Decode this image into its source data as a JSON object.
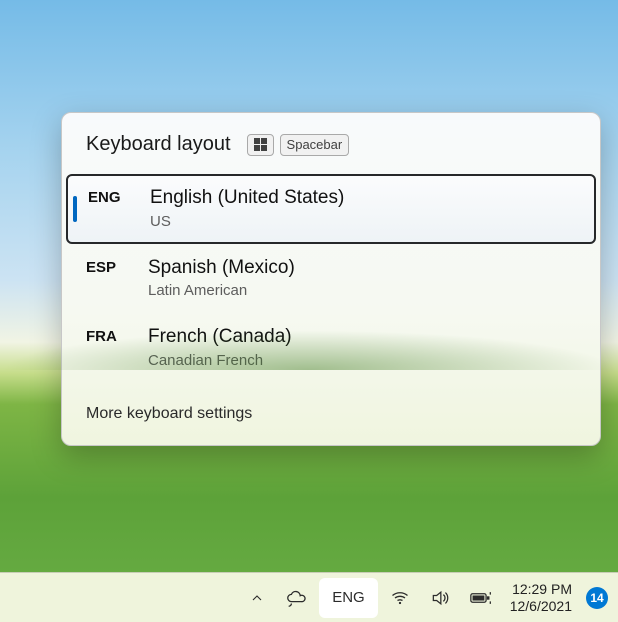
{
  "flyout": {
    "title": "Keyboard layout",
    "shortcut": {
      "spacebar": "Spacebar"
    },
    "options": [
      {
        "code": "ENG",
        "name": "English (United States)",
        "sub": "US",
        "selected": true
      },
      {
        "code": "ESP",
        "name": "Spanish (Mexico)",
        "sub": "Latin American",
        "selected": false
      },
      {
        "code": "FRA",
        "name": "French (Canada)",
        "sub": "Canadian French",
        "selected": false
      }
    ],
    "more": "More keyboard settings"
  },
  "taskbar": {
    "ime": "ENG",
    "time": "12:29 PM",
    "date": "12/6/2021",
    "notification_count": "14"
  }
}
